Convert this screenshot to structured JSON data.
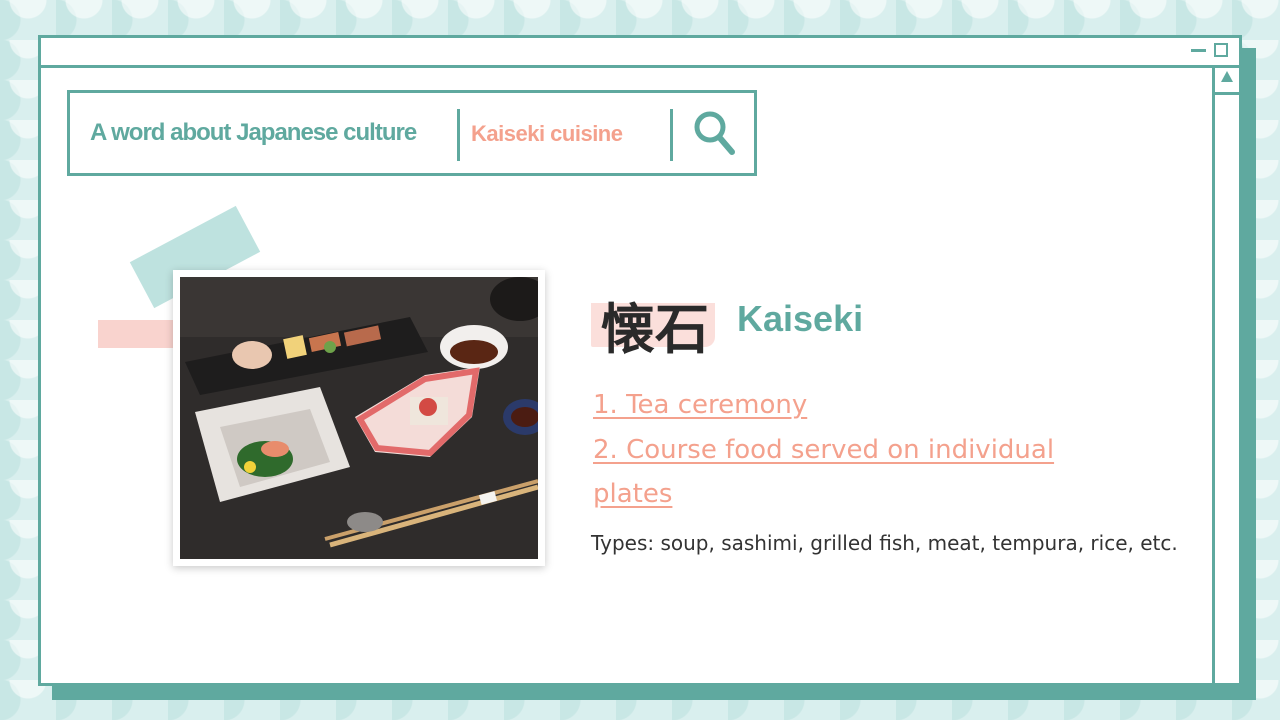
{
  "header": {
    "title": "A word about Japanese culture",
    "subtitle": "Kaiseki cuisine"
  },
  "icons": {
    "search": "search-icon",
    "minimize": "minimize-icon",
    "maximize": "maximize-icon",
    "scroll_up": "scroll-up-arrow-icon"
  },
  "word": {
    "japanese": "懐石",
    "romaji": "Kaiseki"
  },
  "definitions": [
    "1. Tea ceremony",
    "2. Course food served on individual plates"
  ],
  "types_text": "Types: soup, sashimi, grilled fish, meat, tempura, rice, etc.",
  "colors": {
    "accent_teal": "#5fa99f",
    "accent_pink": "#f4a18d",
    "text_dark": "#2a2a2a",
    "background": "#d9efee"
  }
}
